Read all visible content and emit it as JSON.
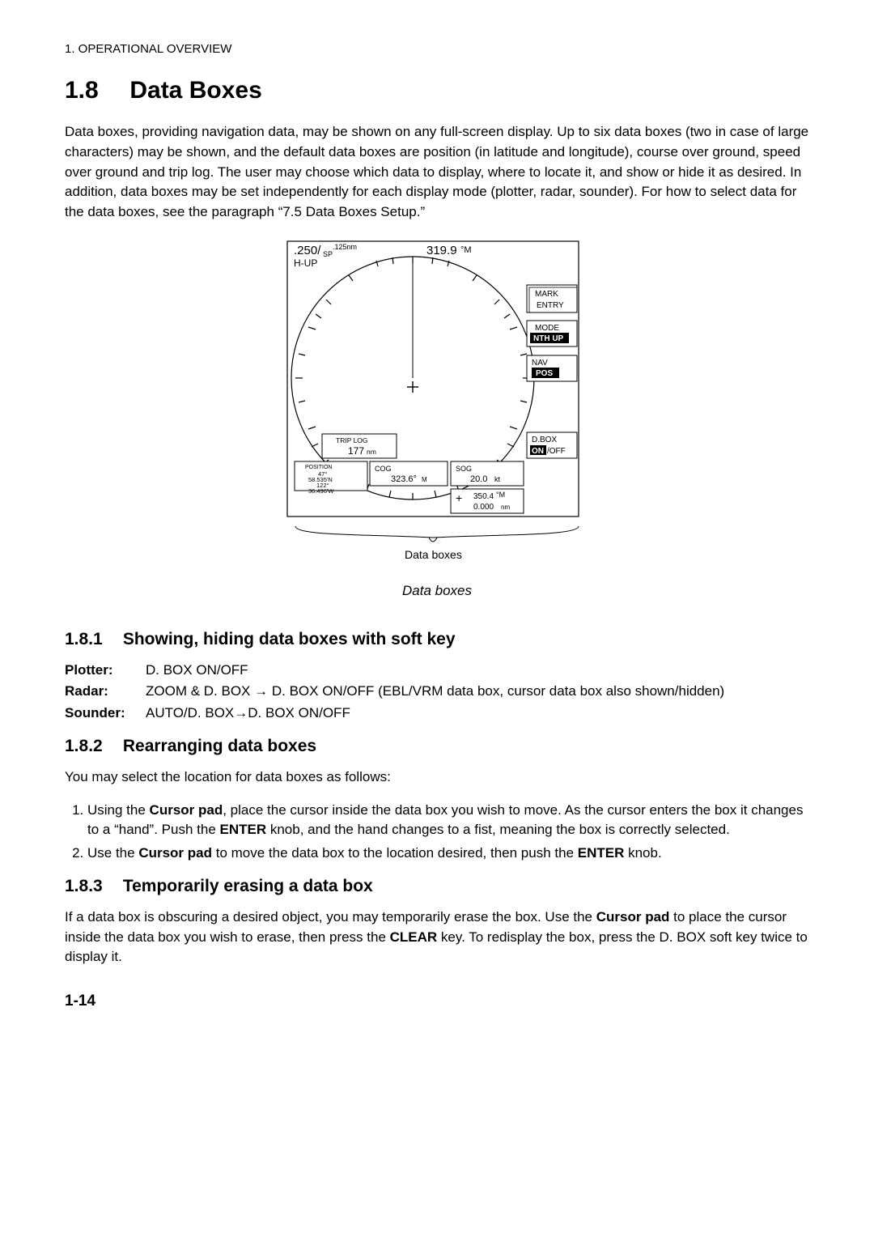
{
  "page_header": "1. OPERATIONAL OVERVIEW",
  "section": {
    "num": "1.8",
    "title": "Data Boxes"
  },
  "intro": "Data boxes, providing navigation data, may be shown on any full-screen display. Up to six data boxes (two in case of large characters) may be shown, and the default data boxes are position (in latitude and longitude), course over ground, speed over ground and trip log. The user may choose which data to display, where to locate it, and show or hide it as desired. In addition, data boxes may be set independently for each display mode (plotter, radar, sounder). For how to select data for the data boxes, see the paragraph “7.5 Data Boxes Setup.”",
  "figure": {
    "top_left": {
      "range": ".250/",
      "sp": "SP",
      "ring_range": ".125nm",
      "mode": "H-UP"
    },
    "heading": {
      "val": "319.9",
      "unit": "°M"
    },
    "softkeys": {
      "mark": "MARK",
      "entry": "ENTRY",
      "mode": "MODE",
      "nth_up": "NTH UP",
      "nav": "NAV",
      "pos": "POS",
      "dbox": "D.BOX",
      "on": "ON",
      "onoff": "/OFF"
    },
    "databoxes": {
      "trip": {
        "label": "TRIP LOG",
        "val": "177",
        "unit": "nm"
      },
      "pos": {
        "label": "POSITION",
        "lat1": "47°",
        "lat2": "58.535'N",
        "lon1": "122°",
        "lon2": "36.496'W"
      },
      "cog": {
        "label": "COG",
        "val": "323.6°",
        "unit": "M"
      },
      "sog": {
        "label": "SOG",
        "val": "20.0",
        "unit": "kt"
      },
      "brg": {
        "brg": "350.4",
        "bunit": "°M",
        "rng": "0.000",
        "runit": "nm"
      }
    },
    "brace_label": "Data boxes",
    "caption": "Data boxes"
  },
  "sec181": {
    "num": "1.8.1",
    "title": "Showing, hiding data boxes with soft key",
    "plotter_l": "Plotter:",
    "plotter_v": "D. BOX ON/OFF",
    "radar_l": "Radar:",
    "radar_v": "ZOOM & D. BOX → D. BOX ON/OFF (EBL/VRM data box, cursor data box also shown/hidden)",
    "sounder_l": "Sounder:",
    "sounder_v": "AUTO/D. BOX→D. BOX ON/OFF"
  },
  "sec182": {
    "num": "1.8.2",
    "title": "Rearranging data boxes",
    "lead": "You may select the location for data boxes as follows:",
    "step1_a": "Using the ",
    "step1_b": "Cursor pad",
    "step1_c": ", place the cursor inside the data box you wish to move. As the cursor enters the box it changes to a “hand”. Push the ",
    "step1_d": "ENTER",
    "step1_e": " knob, and the hand changes to a fist, meaning the box is correctly selected.",
    "step2_a": "Use the ",
    "step2_b": "Cursor pad",
    "step2_c": " to move the data box to the location desired, then push the ",
    "step2_d": "ENTER",
    "step2_e": " knob."
  },
  "sec183": {
    "num": "1.8.3",
    "title": "Temporarily erasing a data box",
    "t1": "If a data box is obscuring a desired object, you may temporarily erase the box. Use the ",
    "t2": "Cursor pad",
    "t3": " to place the cursor inside the data box you wish to erase, then press the ",
    "t4": "CLEAR",
    "t5": " key. To redisplay the box, press the D. BOX soft key twice to display it."
  },
  "page_no": "1-14"
}
